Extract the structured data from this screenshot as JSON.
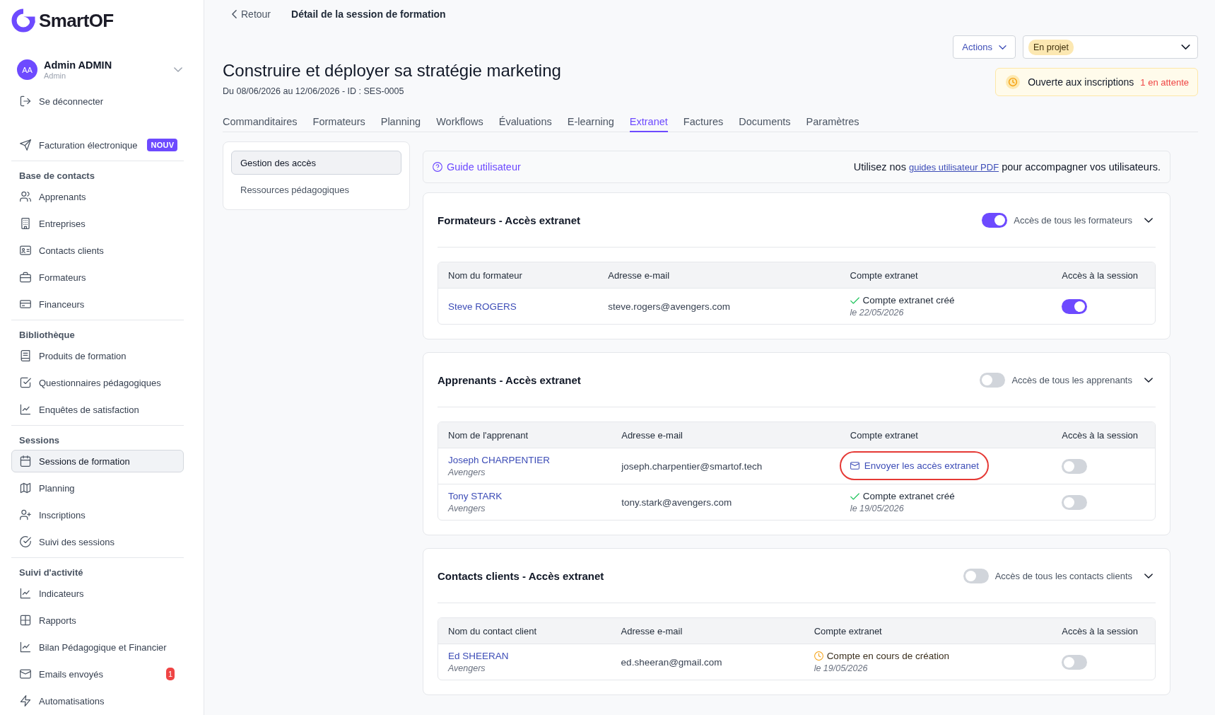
{
  "sidebar": {
    "logo": "SmartOF",
    "user": {
      "initials": "AA",
      "name": "Admin ADMIN",
      "role": "Admin"
    },
    "logout": "Se déconnecter",
    "sections": [
      {
        "items": [
          {
            "label": "Facturation électronique",
            "selected": false,
            "badge": {
              "kind": "new",
              "text": "NOUV"
            }
          }
        ]
      },
      {
        "title": "Base de contacts",
        "items": [
          {
            "label": "Apprenants",
            "selected": false
          },
          {
            "label": "Entreprises",
            "selected": false
          },
          {
            "label": "Contacts clients",
            "selected": false
          },
          {
            "label": "Formateurs",
            "selected": false
          },
          {
            "label": "Financeurs",
            "selected": false
          }
        ]
      },
      {
        "title": "Bibliothèque",
        "items": [
          {
            "label": "Produits de formation",
            "selected": false
          },
          {
            "label": "Questionnaires pédagogiques",
            "selected": false
          },
          {
            "label": "Enquêtes de satisfaction",
            "selected": false
          }
        ]
      },
      {
        "title": "Sessions",
        "items": [
          {
            "label": "Sessions de formation",
            "selected": true
          },
          {
            "label": "Planning",
            "selected": false
          },
          {
            "label": "Inscriptions",
            "selected": false
          },
          {
            "label": "Suivi des sessions",
            "selected": false
          }
        ]
      },
      {
        "title": "Suivi d'activité",
        "items": [
          {
            "label": "Indicateurs",
            "selected": false
          },
          {
            "label": "Rapports",
            "selected": false
          },
          {
            "label": "Bilan Pédagogique et Financier",
            "selected": false
          },
          {
            "label": "Emails envoyés",
            "selected": false,
            "badge": {
              "kind": "alert",
              "text": "1"
            }
          },
          {
            "label": "Automatisations",
            "selected": false
          }
        ]
      }
    ]
  },
  "breadcrumb": {
    "back": "Retour",
    "current": "Détail de la session de formation"
  },
  "header": {
    "title": "Construire et déployer sa stratégie marketing",
    "subtitle": "Du 08/06/2026 au 12/06/2026 - ID : SES-0005",
    "actions": "Actions",
    "status": "En projet",
    "registration": {
      "label": "Ouverte aux inscriptions",
      "pending": "1 en attente"
    }
  },
  "tabs": [
    {
      "label": "Commanditaires",
      "selected": false
    },
    {
      "label": "Formateurs",
      "selected": false
    },
    {
      "label": "Planning",
      "selected": false
    },
    {
      "label": "Workflows",
      "selected": false
    },
    {
      "label": "Évaluations",
      "selected": false
    },
    {
      "label": "E-learning",
      "selected": false
    },
    {
      "label": "Extranet",
      "selected": true
    },
    {
      "label": "Factures",
      "selected": false
    },
    {
      "label": "Documents",
      "selected": false
    },
    {
      "label": "Paramètres",
      "selected": false
    }
  ],
  "subnav": [
    {
      "label": "Gestion des accès",
      "selected": true
    },
    {
      "label": "Ressources pédagogiques",
      "selected": false
    }
  ],
  "guide": {
    "title": "Guide utilisateur",
    "text_before": "Utilisez nos",
    "link": "guides utilisateur PDF",
    "text_after": "pour accompagner vos utilisateurs."
  },
  "sections": [
    {
      "title": "Formateurs - Accès extranet",
      "all_access": {
        "label": "Accès de tous les formateurs",
        "on": true
      },
      "columns": [
        "Nom du formateur",
        "Adresse e-mail",
        "Compte extranet",
        "Accès à la session"
      ],
      "rows": [
        {
          "name": "Steve ROGERS",
          "email": "steve.rogers@avengers.com",
          "account": {
            "kind": "created",
            "label": "Compte extranet créé",
            "date": "le 22/05/2026"
          },
          "access_on": true,
          "highlighted": false
        }
      ]
    },
    {
      "title": "Apprenants - Accès extranet",
      "all_access": {
        "label": "Accès de tous les apprenants",
        "on": false
      },
      "columns": [
        "Nom de l'apprenant",
        "Adresse e-mail",
        "Compte extranet",
        "Accès à la session"
      ],
      "rows": [
        {
          "name": "Joseph CHARPENTIER",
          "company": "Avengers",
          "email": "joseph.charpentier@smartof.tech",
          "account": {
            "kind": "send",
            "label": "Envoyer les accès extranet"
          },
          "access_on": false,
          "highlighted": true
        },
        {
          "name": "Tony STARK",
          "company": "Avengers",
          "email": "tony.stark@avengers.com",
          "account": {
            "kind": "created",
            "label": "Compte extranet créé",
            "date": "le 19/05/2026"
          },
          "access_on": false,
          "highlighted": false
        }
      ]
    },
    {
      "title": "Contacts clients - Accès extranet",
      "all_access": {
        "label": "Accès de tous les contacts clients",
        "on": false
      },
      "columns": [
        "Nom du contact client",
        "Adresse e-mail",
        "Compte extranet",
        "Accès à la session"
      ],
      "rows": [
        {
          "name": "Ed SHEERAN",
          "company": "Avengers",
          "email": "ed.sheeran@gmail.com",
          "account": {
            "kind": "pending",
            "label": "Compte en cours de création",
            "date": "le 19/05/2026"
          },
          "access_on": false,
          "highlighted": false
        }
      ]
    }
  ]
}
